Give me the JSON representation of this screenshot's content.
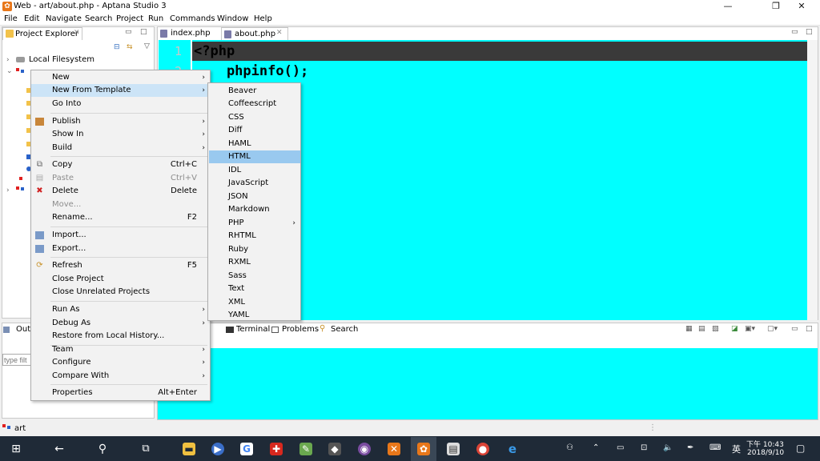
{
  "window": {
    "title": "Web - art/about.php - Aptana Studio 3"
  },
  "menubar": [
    "File",
    "Edit",
    "Navigate",
    "Search",
    "Project",
    "Run",
    "Commands",
    "Window",
    "Help"
  ],
  "project_explorer": {
    "tab_label": "Project Explorer",
    "tree": {
      "local_filesystem": "Local Filesystem"
    }
  },
  "editor": {
    "tabs": [
      {
        "label": "index.php",
        "active": false
      },
      {
        "label": "about.php",
        "active": true
      }
    ],
    "lines": [
      "<?php",
      "    phpinfo();"
    ],
    "line_numbers": [
      "1",
      "2"
    ],
    "background_color": "#00ffff",
    "current_line_color": "#3a3a3a"
  },
  "outline": {
    "tab_label": "Outl",
    "filter_placeholder": "type filt"
  },
  "bottom_panel": {
    "tabs": [
      "Terminal",
      "Problems",
      "Search"
    ]
  },
  "context_menu": {
    "items": [
      {
        "label": "New",
        "submenu": true
      },
      {
        "label": "New From Template",
        "submenu": true,
        "highlighted": true
      },
      {
        "label": "Go Into"
      },
      {
        "label": "Publish",
        "submenu": true
      },
      {
        "label": "Show In",
        "submenu": true
      },
      {
        "label": "Build",
        "submenu": true
      },
      {
        "label": "Copy",
        "shortcut": "Ctrl+C"
      },
      {
        "label": "Paste",
        "shortcut": "Ctrl+V",
        "disabled": true
      },
      {
        "label": "Delete",
        "shortcut": "Delete"
      },
      {
        "label": "Move...",
        "disabled": true
      },
      {
        "label": "Rename...",
        "shortcut": "F2"
      },
      {
        "label": "Import..."
      },
      {
        "label": "Export..."
      },
      {
        "label": "Refresh",
        "shortcut": "F5"
      },
      {
        "label": "Close Project"
      },
      {
        "label": "Close Unrelated Projects"
      },
      {
        "label": "Run As",
        "submenu": true
      },
      {
        "label": "Debug As",
        "submenu": true
      },
      {
        "label": "Restore from Local History..."
      },
      {
        "label": "Team",
        "submenu": true
      },
      {
        "label": "Configure",
        "submenu": true
      },
      {
        "label": "Compare With",
        "submenu": true
      },
      {
        "label": "Properties",
        "shortcut": "Alt+Enter"
      }
    ]
  },
  "template_submenu": {
    "items": [
      "Beaver",
      "Coffeescript",
      "CSS",
      "Diff",
      "HAML",
      "HTML",
      "IDL",
      "JavaScript",
      "JSON",
      "Markdown",
      "PHP",
      "RHTML",
      "Ruby",
      "RXML",
      "Sass",
      "Text",
      "XML",
      "YAML"
    ],
    "highlighted": "HTML",
    "submenu_item": "PHP"
  },
  "status_bar": {
    "text": "art"
  },
  "taskbar": {
    "time": "下午 10:43",
    "date": "2018/9/10",
    "ime": "英"
  }
}
